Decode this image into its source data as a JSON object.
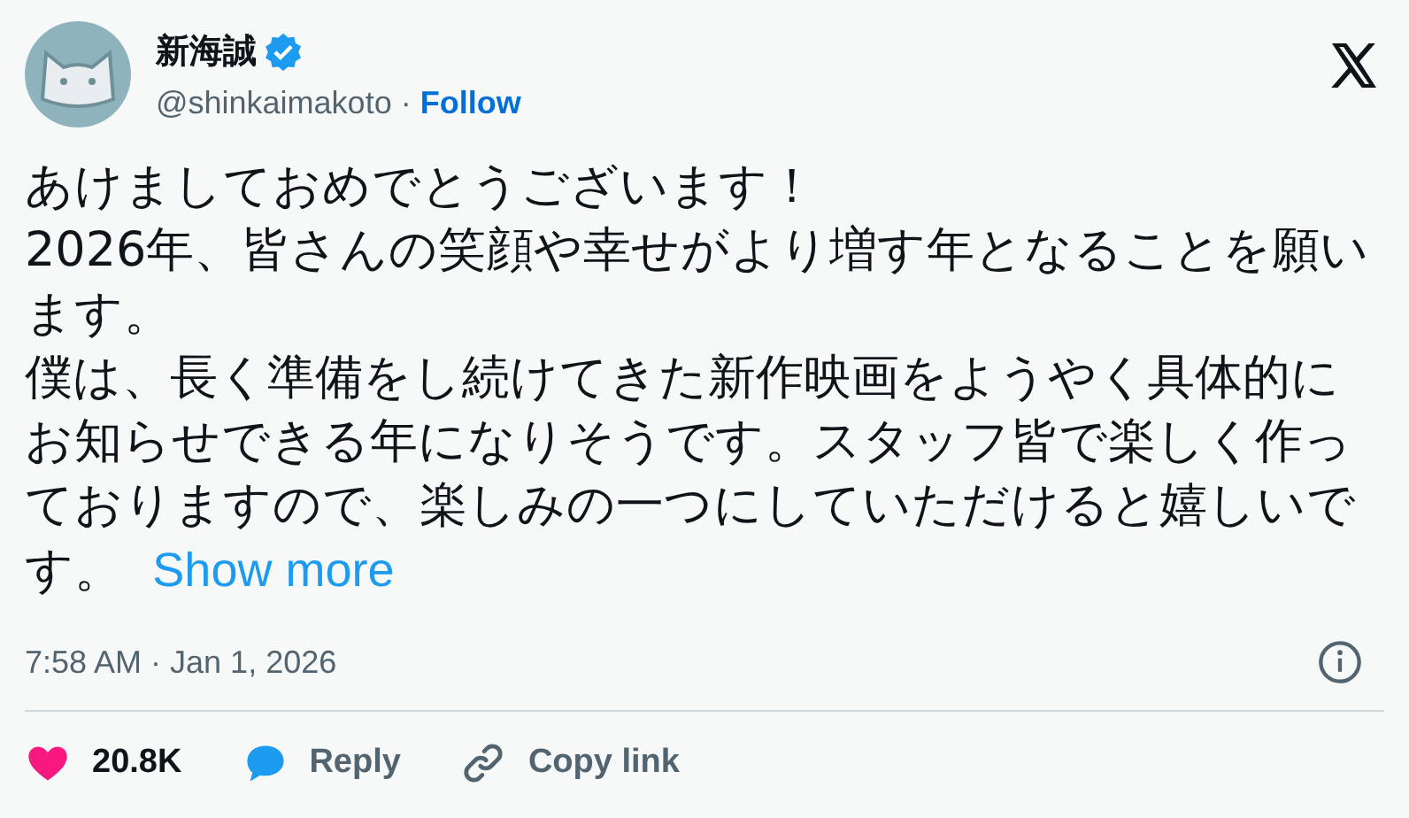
{
  "author": {
    "name": "新海誠",
    "handle": "@shinkaimakoto",
    "separator": "·",
    "follow": "Follow"
  },
  "body": {
    "paragraphs": [
      "あけましておめでとうございます！",
      "2026年、皆さんの笑顔や幸せがより増す年となることを願います。",
      "僕は、長く準備をし続けてきた新作映画をようやく具体的にお知らせできる年になりそうです。スタッフ皆で楽しく作っておりますので、楽しみの一つにしていただけると嬉しいです。"
    ],
    "show_more": "Show more"
  },
  "timestamp": "7:58 AM · Jan 1, 2026",
  "actions": [
    {
      "kind": "like",
      "label": "20.8K"
    },
    {
      "kind": "reply",
      "label": "Reply"
    },
    {
      "kind": "copy",
      "label": "Copy link"
    }
  ]
}
